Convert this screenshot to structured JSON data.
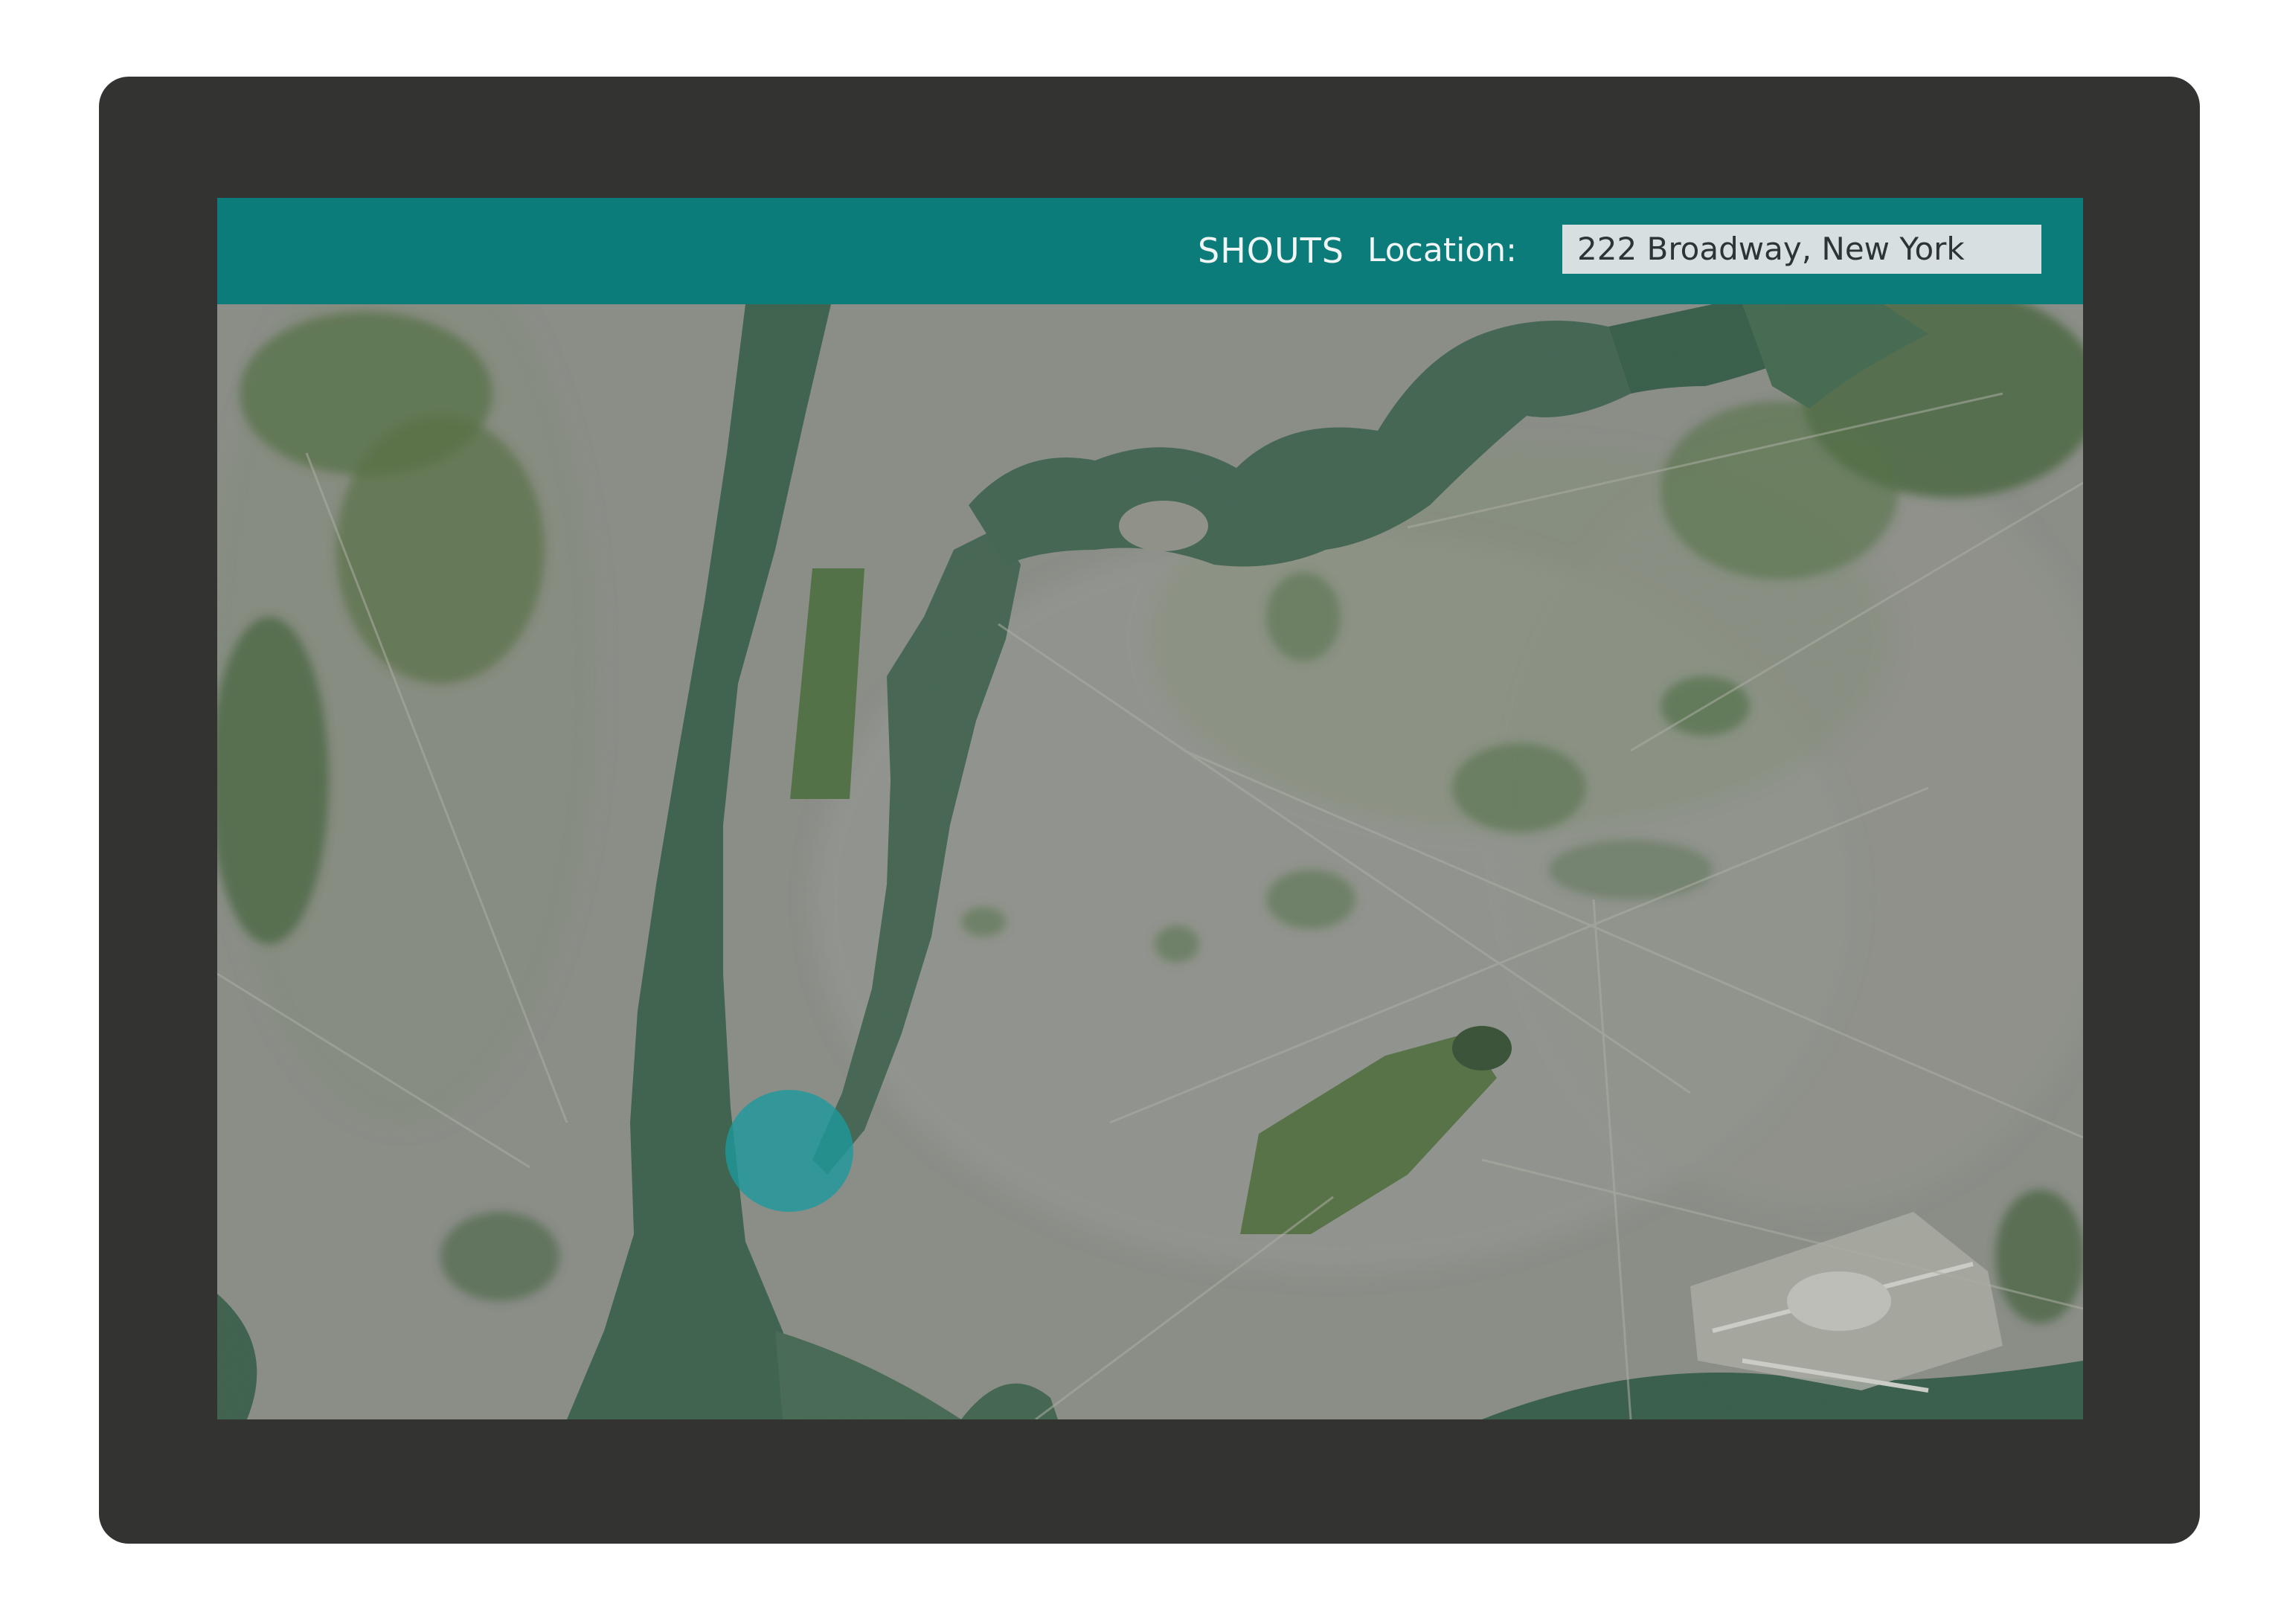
{
  "app": {
    "brand": "SHOUTS"
  },
  "search": {
    "label": "Location:",
    "value": "222 Broadway, New York"
  },
  "map": {
    "view": "satellite",
    "marker_icon": "location-circle",
    "locate_icon": "locate-icon"
  },
  "colors": {
    "accent": "#0c7c7a",
    "marker": "#1b9a9e",
    "device_frame": "#333332",
    "input_background": "#d7dfe1"
  }
}
